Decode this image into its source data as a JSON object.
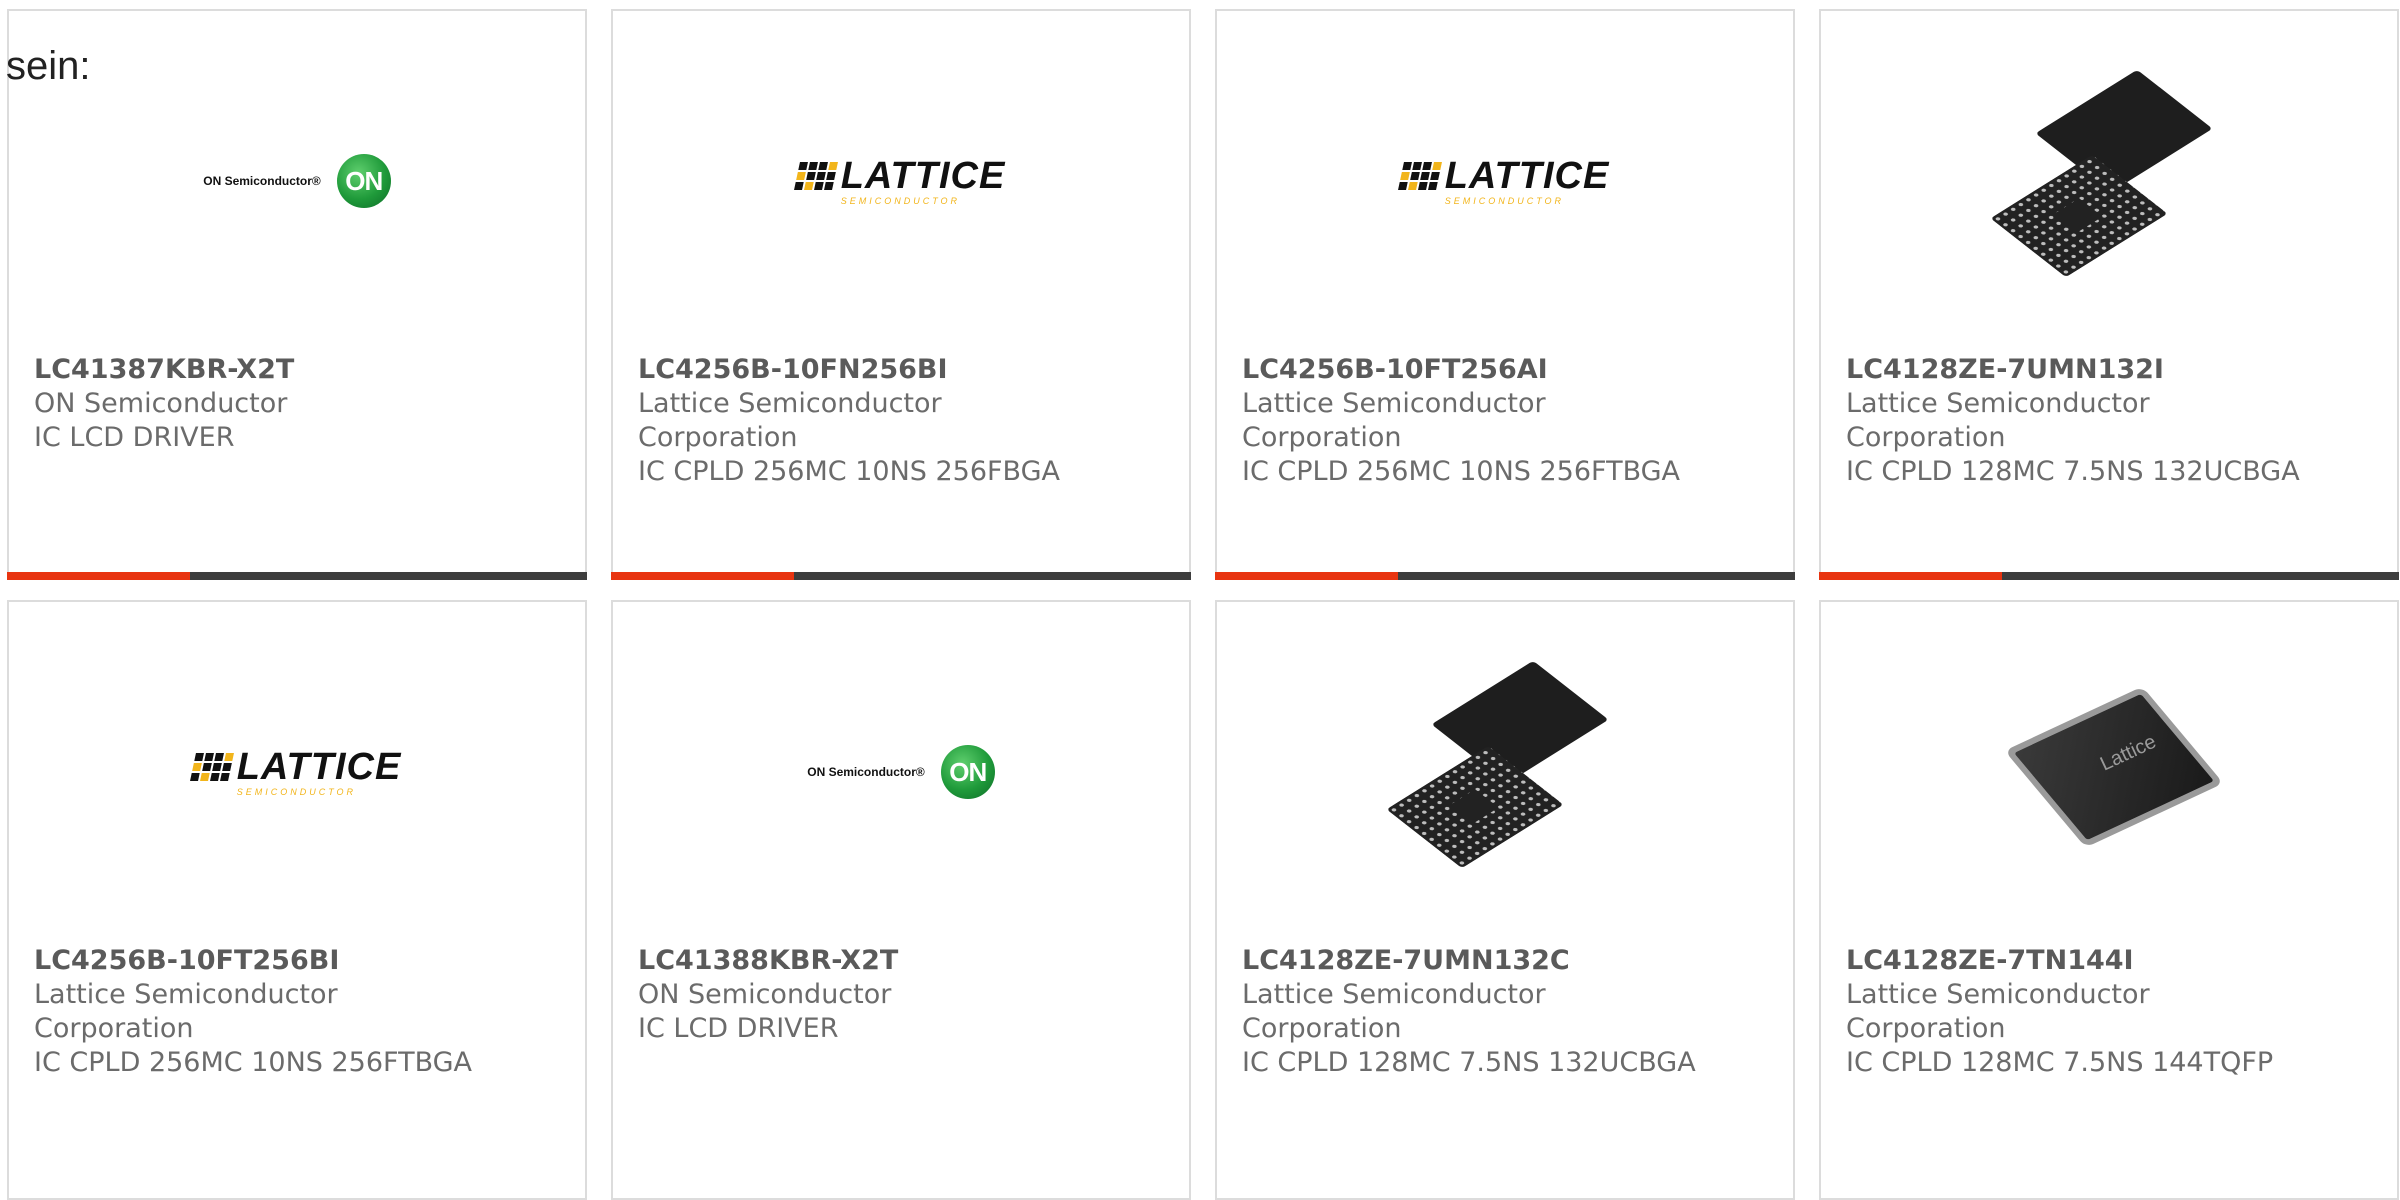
{
  "intro_text": "sein:",
  "cards": [
    {
      "part_number": "LC41387KBR-X2T",
      "manufacturer": [
        "ON Semiconductor"
      ],
      "description": "IC LCD DRIVER",
      "image": "on-semiconductor-logo"
    },
    {
      "part_number": "LC4256B-10FN256BI",
      "manufacturer": [
        "Lattice Semiconductor",
        "Corporation"
      ],
      "description": "IC CPLD 256MC 10NS 256FBGA",
      "image": "lattice-logo"
    },
    {
      "part_number": "LC4256B-10FT256AI",
      "manufacturer": [
        "Lattice Semiconductor",
        "Corporation"
      ],
      "description": "IC CPLD 256MC 10NS 256FTBGA",
      "image": "lattice-logo"
    },
    {
      "part_number": "LC4128ZE-7UMN132I",
      "manufacturer": [
        "Lattice Semiconductor",
        "Corporation"
      ],
      "description": "IC CPLD 128MC 7.5NS 132UCBGA",
      "image": "bga-chip-photo"
    },
    {
      "part_number": "LC4256B-10FT256BI",
      "manufacturer": [
        "Lattice Semiconductor",
        "Corporation"
      ],
      "description": "IC CPLD 256MC 10NS 256FTBGA",
      "image": "lattice-logo"
    },
    {
      "part_number": "LC41388KBR-X2T",
      "manufacturer": [
        "ON Semiconductor"
      ],
      "description": "IC LCD DRIVER",
      "image": "on-semiconductor-logo"
    },
    {
      "part_number": "LC4128ZE-7UMN132C",
      "manufacturer": [
        "Lattice Semiconductor",
        "Corporation"
      ],
      "description": "IC CPLD 128MC 7.5NS 132UCBGA",
      "image": "bga-chip-photo"
    },
    {
      "part_number": "LC4128ZE-7TN144I",
      "manufacturer": [
        "Lattice Semiconductor",
        "Corporation"
      ],
      "description": "IC CPLD 128MC 7.5NS 144TQFP",
      "image": "tqfp-chip-photo"
    }
  ],
  "logos": {
    "on_text": "ON Semiconductor®",
    "on_ball": "ON",
    "lattice_word": "LATTICE",
    "lattice_sub": "SEMICONDUCTOR",
    "tqfp_mark": "Lattice"
  },
  "colors": {
    "accent_red": "#e83410",
    "accent_dark": "#3d3d3d",
    "card_border": "#dcdcdc",
    "text_gray": "#6b6b6b",
    "lattice_yellow": "#f2b51b",
    "on_green": "#1f9a3a"
  }
}
